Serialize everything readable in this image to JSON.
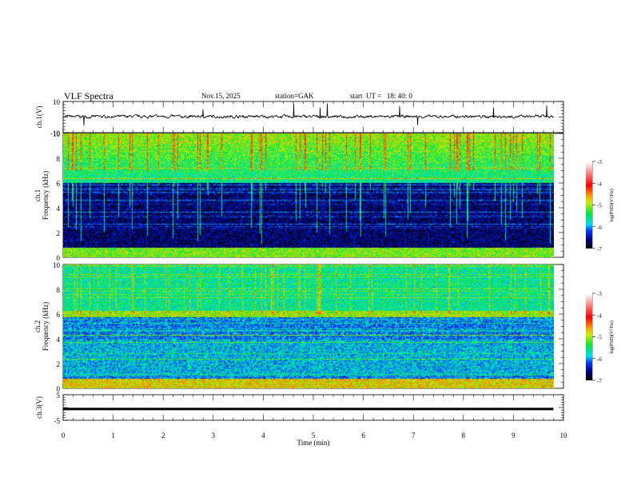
{
  "header": {
    "title": "VLF Spectra",
    "date": "Nov.15, 2025",
    "station": "station=GAK",
    "start": "start  UT =   18: 40: 0"
  },
  "chart_data": [
    {
      "type": "line",
      "name": "ch1-waveform",
      "ylabel": "ch.1(V)",
      "ylim": [
        -10,
        10
      ],
      "yticks": [
        "10",
        "-10"
      ],
      "baseline": 0,
      "xlim": [
        0,
        10
      ]
    },
    {
      "type": "heatmap",
      "name": "ch1-spectrogram",
      "ylabel_lines": [
        "ch.1",
        "Frequency  (kHz)"
      ],
      "ylim": [
        0,
        10
      ],
      "yticks": [
        "0",
        "2",
        "4",
        "6",
        "8",
        "10"
      ],
      "xlim": [
        0,
        10
      ],
      "data_end_min": 9.8,
      "colorbar": {
        "label": "log(PSD)(V²/Hz)",
        "range": [
          -7,
          -3
        ],
        "ticks": [
          "-3",
          "-4",
          "-5",
          "-6",
          "-7"
        ]
      }
    },
    {
      "type": "heatmap",
      "name": "ch2-spectrogram",
      "ylabel_lines": [
        "ch.2",
        "Frequency  (kHz)"
      ],
      "ylim": [
        0,
        10
      ],
      "yticks": [
        "0",
        "2",
        "4",
        "6",
        "8",
        "10"
      ],
      "xlim": [
        0,
        10
      ],
      "data_end_min": 9.8,
      "colorbar": {
        "label": "log(PSD)(V²/Hz)",
        "range": [
          -7,
          -3
        ],
        "ticks": [
          "-3",
          "-4",
          "-5",
          "-6",
          "-7"
        ]
      }
    },
    {
      "type": "line",
      "name": "ch3-waveform",
      "ylabel": "ch.3(V)",
      "ylim": [
        -5,
        5
      ],
      "yticks": [
        "5",
        "-5"
      ],
      "value": -0.6,
      "xlim": [
        0,
        10
      ],
      "xlabel": "Time  (min)",
      "xticks": [
        "0",
        "1",
        "2",
        "3",
        "4",
        "5",
        "6",
        "7",
        "8",
        "9",
        "10"
      ]
    }
  ]
}
